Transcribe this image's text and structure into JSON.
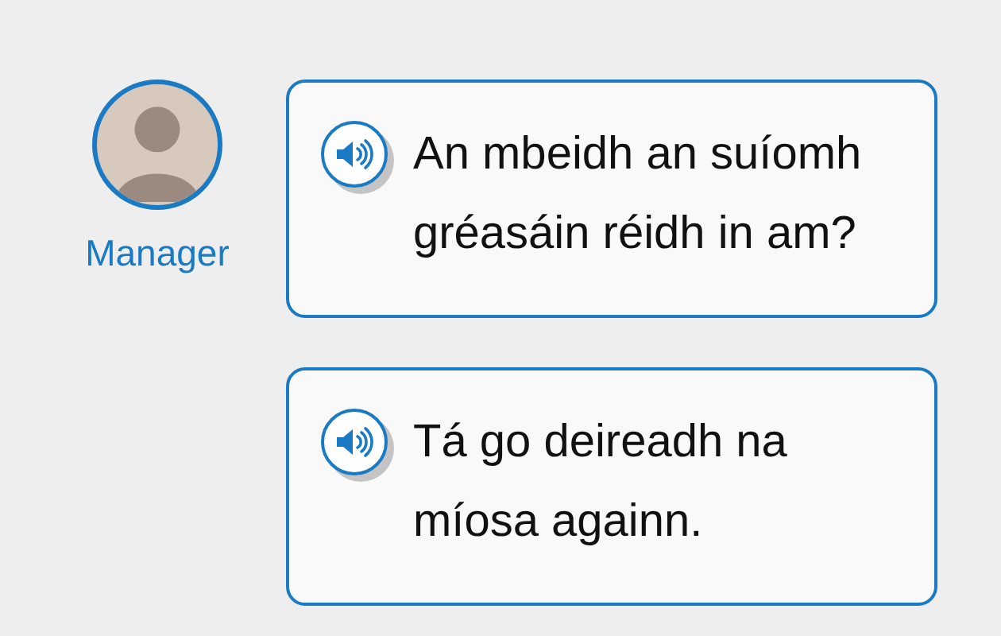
{
  "messages": [
    {
      "speaker": "Manager",
      "text": "An mbeidh an suíomh gréasáin réidh in am?"
    },
    {
      "text": "Tá go deireadh na míosa againn."
    }
  ]
}
